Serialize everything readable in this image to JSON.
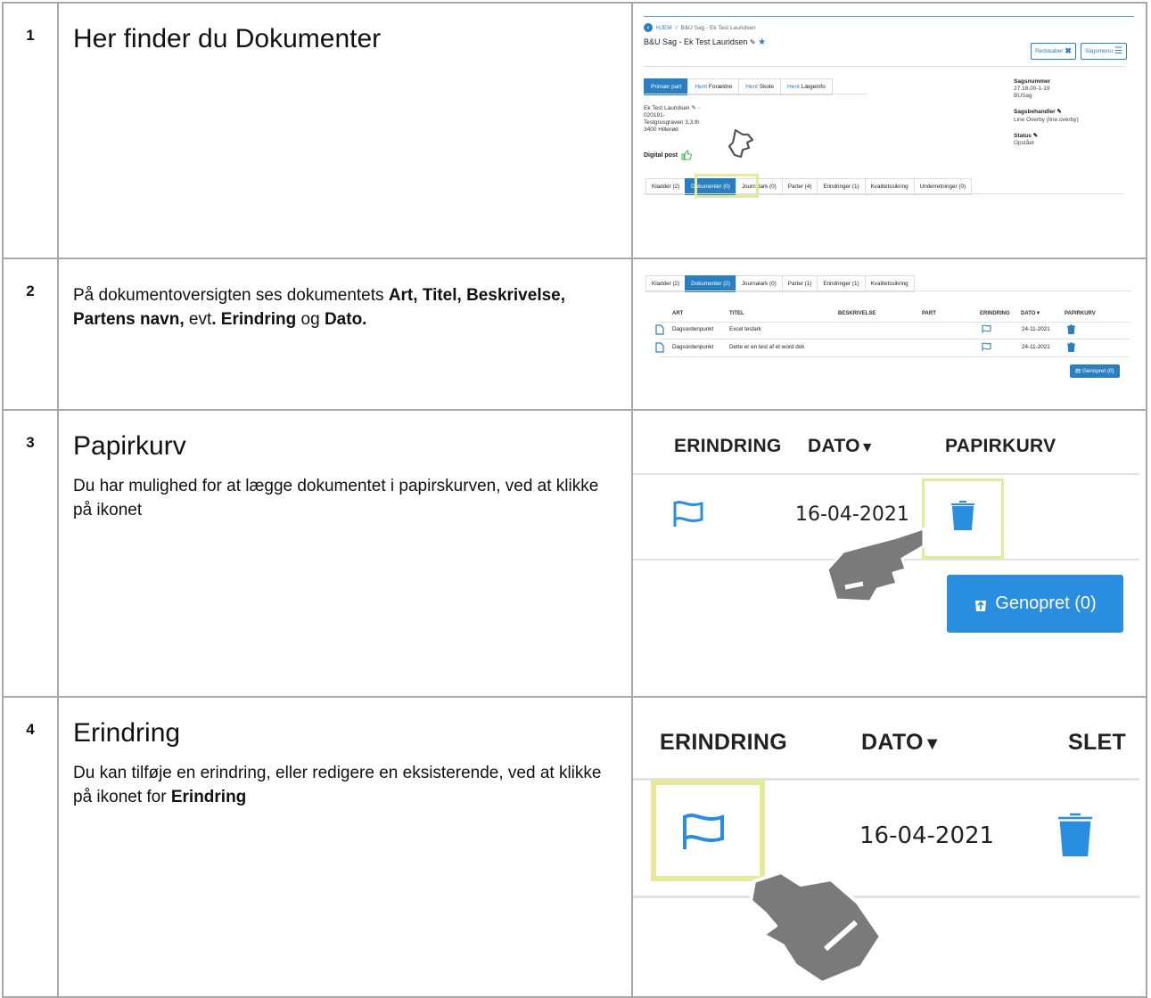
{
  "rows": [
    {
      "num": "1",
      "heading": "Her finder du Dokumenter"
    },
    {
      "num": "2",
      "text_parts": [
        "På dokumentoversigten ses dokumentets ",
        "Art, Titel, Beskrivelse, Partens navn,",
        " evt",
        ". Erindring",
        " og ",
        "Dato."
      ]
    },
    {
      "num": "3",
      "heading": "Papirkurv",
      "text": "Du har mulighed for at lægge dokumentet i papirskurven, ved at klikke på ikonet"
    },
    {
      "num": "4",
      "heading": "Erindring",
      "text_before": "Du kan tilføje en erindring, eller redigere en eksisterende, ved at klikke på ikonet for ",
      "text_bold": "Erindring"
    }
  ],
  "shot1": {
    "breadcrumb_home": "HJEM",
    "breadcrumb_sep": "/",
    "breadcrumb_case": "B&U Sag - Ek Test Lauridsen",
    "title": "B&U Sag - Ek Test Lauridsen",
    "btn_tools": "Redskaber",
    "btn_menu": "Sagsmenu",
    "party_tabs": [
      {
        "prefix": "",
        "label": "Primær part"
      },
      {
        "prefix": "Hent",
        "label": "Forældre"
      },
      {
        "prefix": "Hent",
        "label": "Skole"
      },
      {
        "prefix": "Hent",
        "label": "Lægeinfo"
      }
    ],
    "party_name": "Ek Test Lauridsen",
    "party_cpr": "020191-",
    "party_street": "Testgrusgraven 3,3.th",
    "party_city": "3400 Hillerød",
    "digital_post": "Digital post",
    "case_number_label": "Sagsnummer",
    "case_number": "27.18.00-1-19",
    "case_type": "BUSag",
    "handler_label": "Sagsbehandler",
    "handler": "Line Overby (line.overby)",
    "status_label": "Status",
    "status": "Opstået",
    "doc_tabs": [
      "Kladder (2)",
      "Dokumenter (0)",
      "Journalark (0)",
      "Parter (4)",
      "Erindringer (1)",
      "Kvalitetssikring",
      "Underretninger (0)"
    ]
  },
  "shot2": {
    "doc_tabs": [
      "Kladder (2)",
      "Dokumenter (2)",
      "Journalark (0)",
      "Parter (1)",
      "Erindringer (1)",
      "Kvalitetssikring"
    ],
    "columns": {
      "art": "ART",
      "titel": "TITEL",
      "beskrivelse": "BESKRIVELSE",
      "part": "PART",
      "erindring": "ERINDRING",
      "dato": "DATO",
      "papirkurv": "PAPIRKURV"
    },
    "rows": [
      {
        "art": "Dagsordenpunkt",
        "titel": "Excel testark",
        "dato": "24-11-2021"
      },
      {
        "art": "Dagsordenpunkt",
        "titel": "Dette er en test af et word dok",
        "dato": "24-11-2021"
      }
    ],
    "restore_btn": "Genopret (0)"
  },
  "shot3": {
    "col_erindring": "ERINDRING",
    "col_dato": "DATO",
    "col_papirkurv": "PAPIRKURV",
    "date": "16-04-2021",
    "restore_btn": "Genopret (0)"
  },
  "shot4": {
    "col_erindring": "ERINDRING",
    "col_dato": "DATO",
    "col_slet": "SLET",
    "date": "16-04-2021"
  },
  "colors": {
    "accent": "#2a7fc1",
    "highlight": "#e5ea9a",
    "hand": "#7a7a7a"
  },
  "icons": [
    "back-arrow-icon",
    "pencil-icon",
    "star-icon",
    "tools-icon",
    "menu-icon",
    "trash-icon",
    "thumbs-up-icon",
    "pointer-hand-icon",
    "document-icon",
    "flag-icon",
    "sort-caret-icon",
    "restore-icon"
  ]
}
